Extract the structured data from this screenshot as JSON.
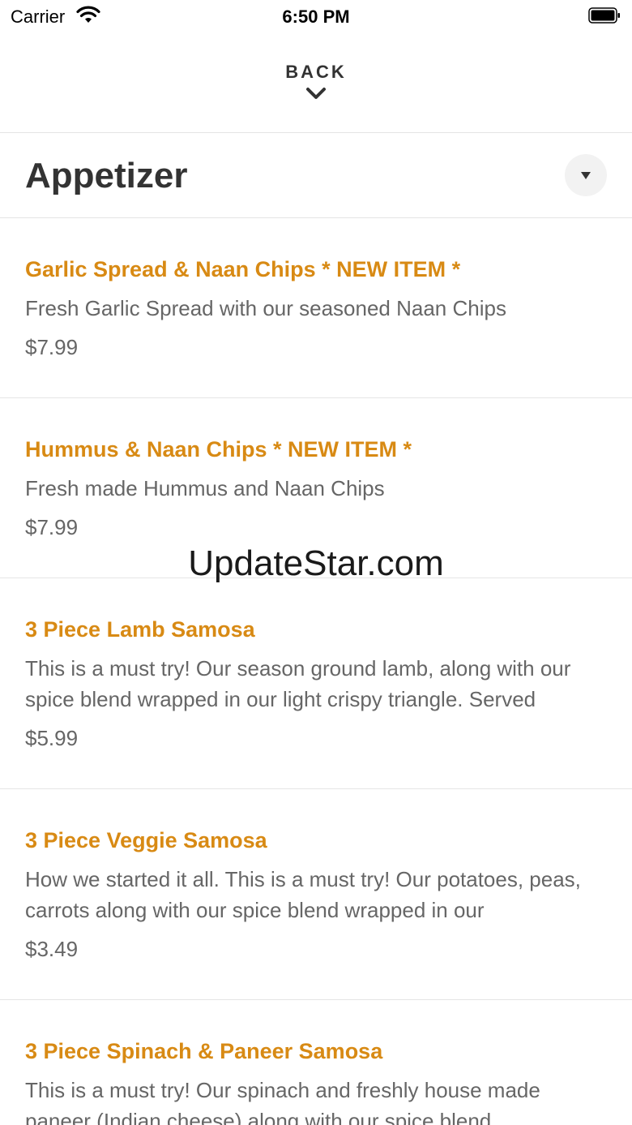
{
  "status_bar": {
    "carrier": "Carrier",
    "time": "6:50 PM",
    "wifi_icon": "wifi-icon",
    "battery_icon": "battery-icon"
  },
  "nav": {
    "back_label": "BACK",
    "chevron_icon": "chevron-down-icon"
  },
  "category": {
    "title": "Appetizer",
    "dropdown_icon": "caret-down-icon"
  },
  "items": [
    {
      "name": "Garlic Spread & Naan Chips * NEW ITEM *",
      "description": "Fresh Garlic Spread with our seasoned Naan Chips",
      "price": "$7.99"
    },
    {
      "name": "Hummus & Naan Chips * NEW ITEM *",
      "description": "Fresh made Hummus and Naan Chips",
      "price": "$7.99"
    },
    {
      "name": "3 Piece Lamb Samosa",
      "description": "This is a must try! Our season ground lamb, along with our spice blend wrapped in our light crispy triangle. Served",
      "price": "$5.99"
    },
    {
      "name": "3 Piece Veggie Samosa",
      "description": "How we started it all. This is a must try! Our potatoes, peas, carrots along with our spice blend wrapped in our",
      "price": "$3.49"
    },
    {
      "name": "3 Piece Spinach & Paneer Samosa",
      "description": "This is a must try! Our spinach and freshly house made paneer (Indian cheese) along with our spice blend",
      "price": ""
    }
  ],
  "watermark": "UpdateStar.com",
  "colors": {
    "accent": "#d88a14",
    "text_primary": "#333333",
    "text_secondary": "#666666",
    "divider": "#e5e5e5"
  }
}
